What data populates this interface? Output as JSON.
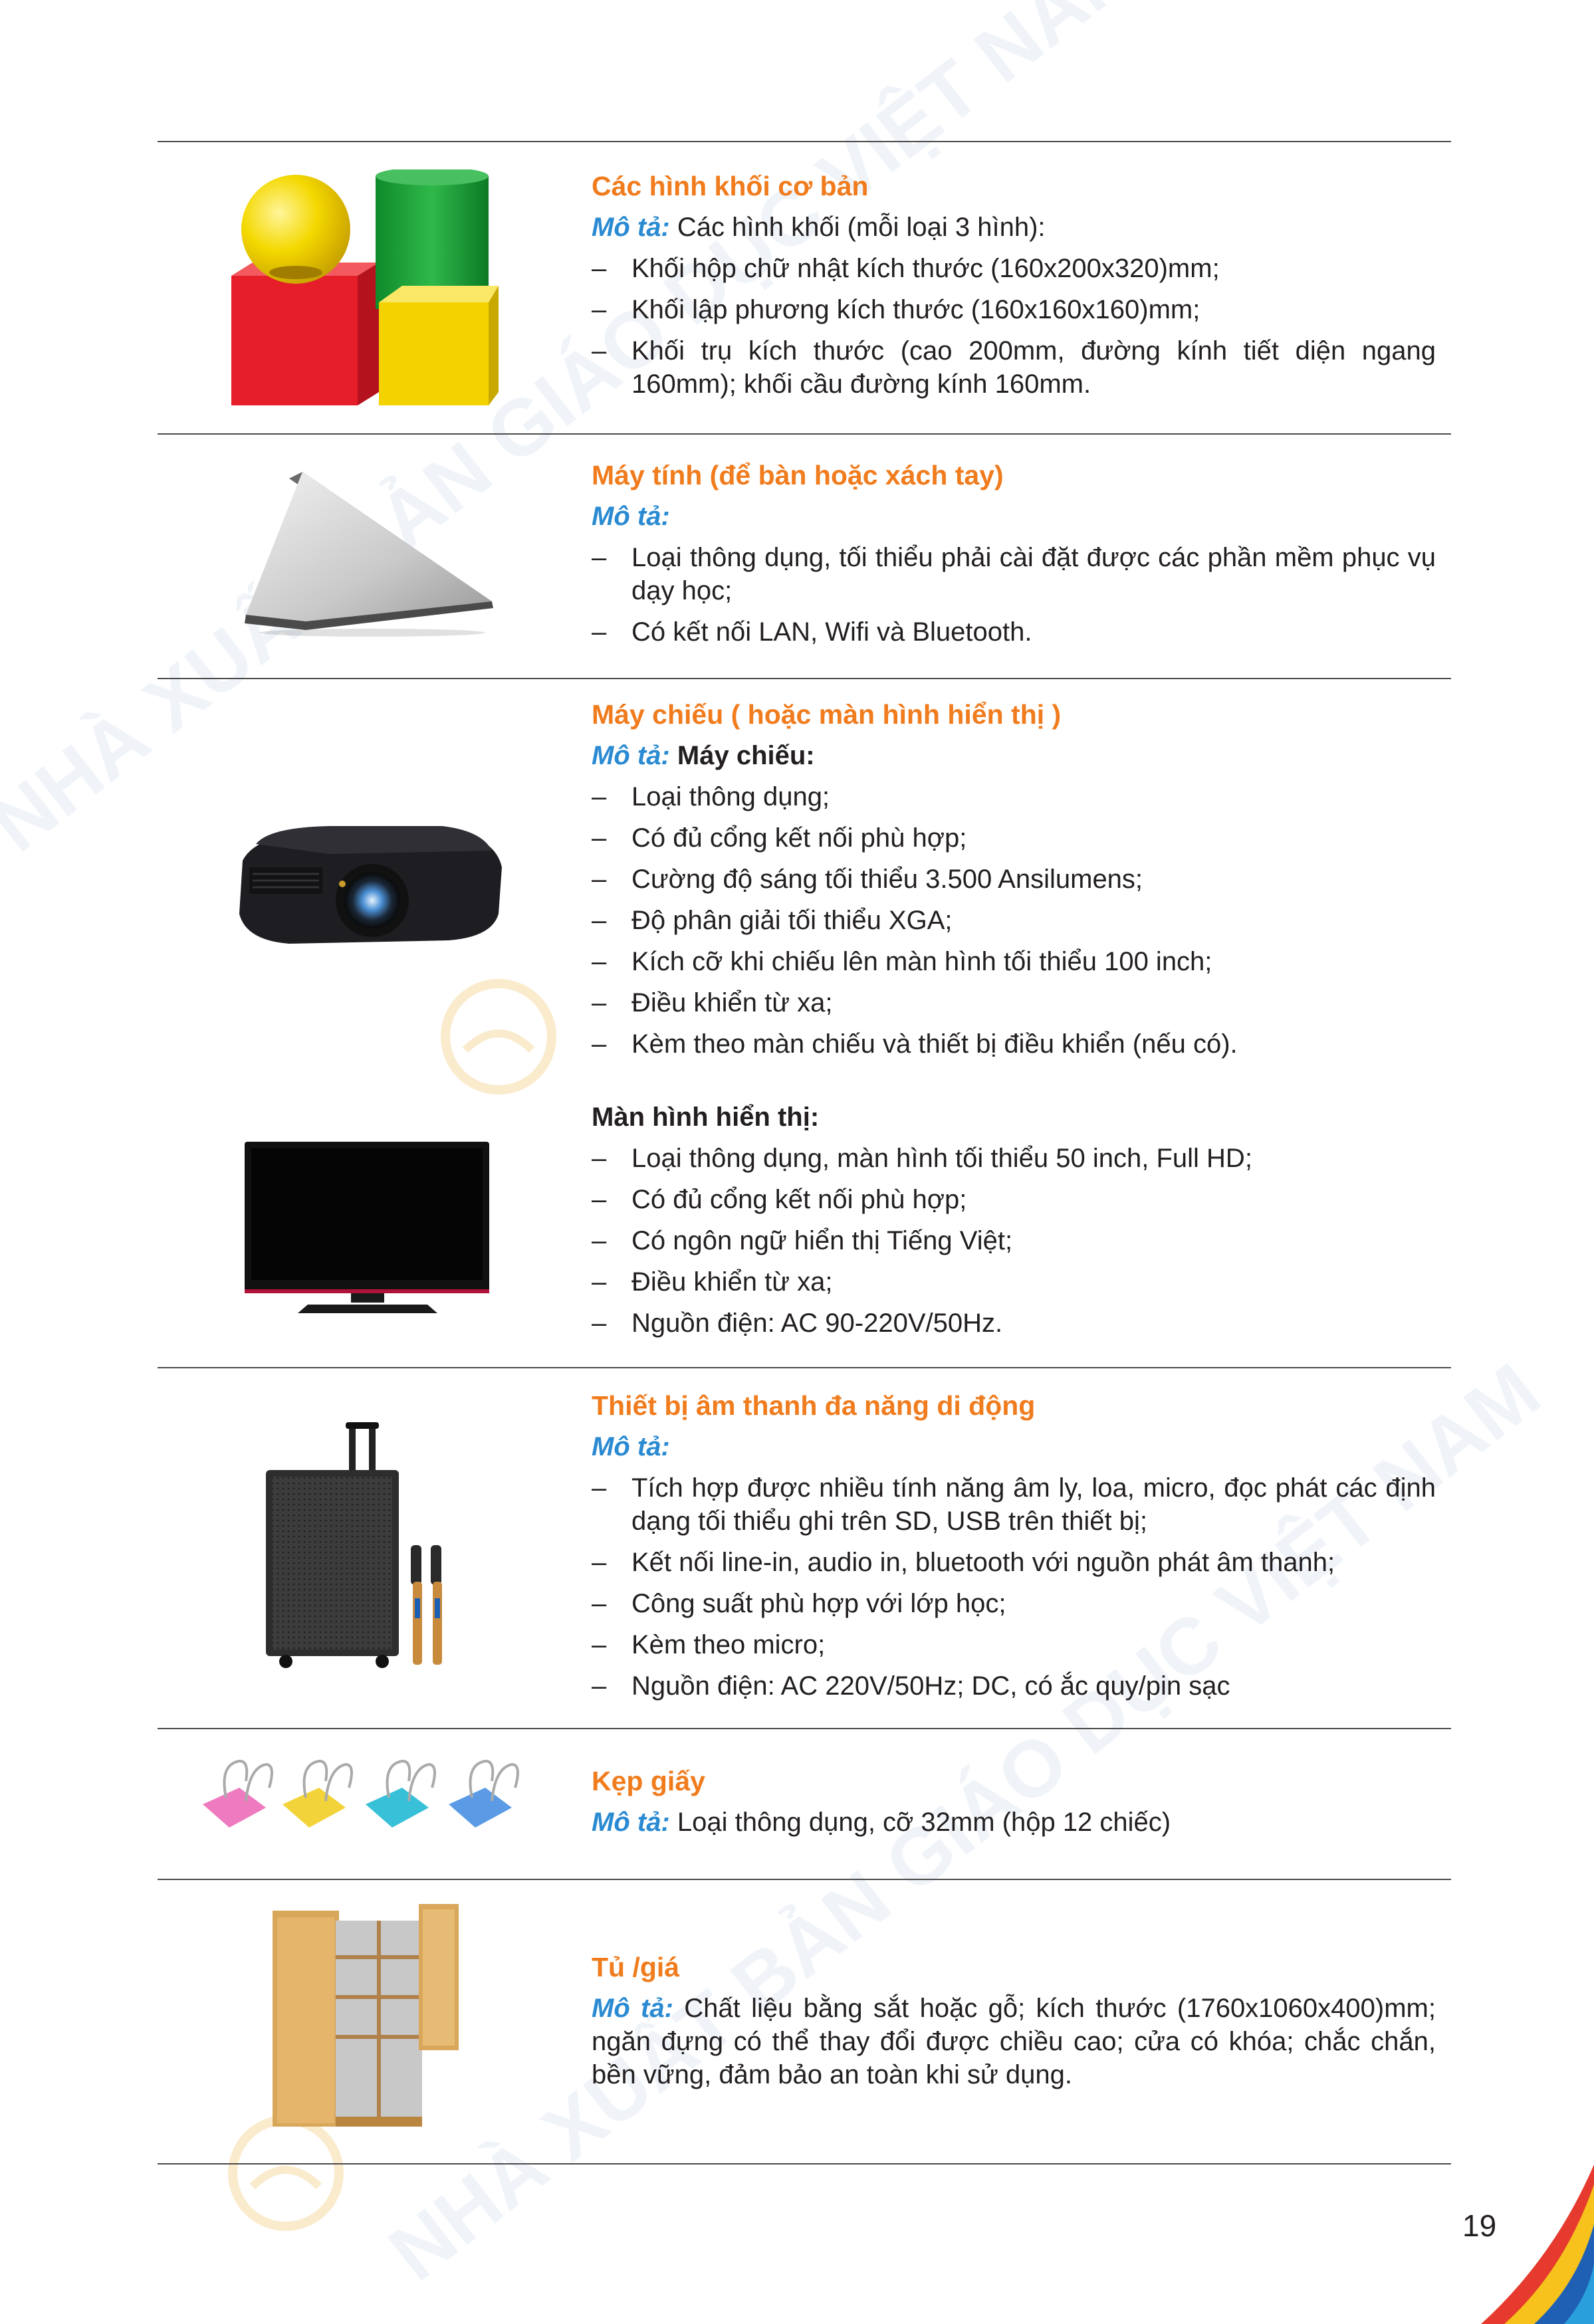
{
  "watermark": {
    "publisher": "NHÀ XUẤT BẢN GIÁO DỤC VIỆT NAM"
  },
  "colors": {
    "title": "#f07c1e",
    "description_label": "#2a8ad2",
    "rule": "#4a4a4a",
    "text": "#231f20"
  },
  "items": [
    {
      "title": "Các hình khối cơ bản",
      "description_label": "Mô tả:",
      "description_text": "Các hình khối (mỗi loại 3 hình):",
      "bullets": [
        "Khối hộp chữ nhật kích thước (160x200x320)mm;",
        "Khối lập phương kích thước (160x160x160)mm;",
        "Khối trụ kích thước (cao 200mm, đường kính tiết diện ngang 160mm); khối cầu đường kính 160mm."
      ]
    },
    {
      "title": "Máy tính (để bàn hoặc xách tay)",
      "description_label": "Mô tả:",
      "bullets": [
        "Loại thông dụng, tối thiểu phải cài đặt được các phần mềm phục vụ dạy học;",
        "Có kết nối LAN, Wifi và Bluetooth."
      ]
    },
    {
      "title": "Máy chiếu ( hoặc màn hình hiển thị )",
      "description_label": "Mô tả:",
      "projector_heading": "Máy chiếu:",
      "projector_bullets": [
        "Loại thông dụng;",
        "Có đủ cổng kết nối phù hợp;",
        "Cường độ sáng tối thiểu 3.500 Ansilumens;",
        "Độ phân giải tối thiểu XGA;",
        "Kích cỡ khi chiếu lên màn hình tối thiểu 100 inch;",
        "Điều khiển từ xa;",
        "Kèm theo màn chiếu và thiết bị điều khiển (nếu có)."
      ],
      "display_heading": "Màn hình hiển thị:",
      "display_bullets": [
        "Loại thông dụng, màn hình tối thiểu 50 inch, Full HD;",
        "Có đủ cổng kết nối phù hợp;",
        "Có ngôn ngữ hiển thị Tiếng Việt;",
        "Điều khiển từ xa;",
        "Nguồn điện: AC 90-220V/50Hz."
      ]
    },
    {
      "title": "Thiết bị âm thanh đa năng di động",
      "description_label": "Mô tả:",
      "bullets": [
        "Tích hợp được nhiều tính năng âm ly, loa, micro, đọc phát các định dạng tối thiểu ghi trên SD, USB trên thiết bị;",
        "Kết nối line-in, audio in, bluetooth với nguồn phát âm thanh;",
        "Công suất phù hợp với lớp học;",
        "Kèm theo micro;",
        "Nguồn điện: AC 220V/50Hz; DC, có ắc quy/pin sạc"
      ]
    },
    {
      "title": "Kẹp giấy",
      "description_label": "Mô tả:",
      "description_text": "Loại thông dụng, cỡ 32mm (hộp 12 chiếc)"
    },
    {
      "title": "Tủ /giá",
      "description_label": "Mô tả:",
      "description_text": "Chất liệu bằng sắt hoặc gỗ; kích thước (1760x1060x400)mm; ngăn đựng có thể thay đổi được chiều cao; cửa có khóa; chắc chắn, bền vững, đảm bảo an toàn khi sử dụng."
    }
  ],
  "page_number": "19"
}
